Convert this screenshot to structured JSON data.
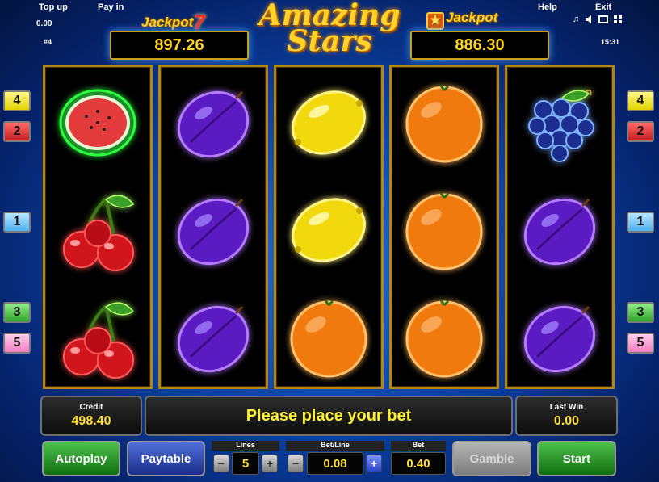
{
  "topbar": {
    "top_up": "Top up",
    "pay_in": "Pay in",
    "help": "Help",
    "exit": "Exit",
    "balance": "0.00",
    "game_no": "#4",
    "clock": "15:31"
  },
  "jackpots": {
    "left_label": "Jackpot",
    "left_symbol": "7",
    "left_value": "897.26",
    "right_label": "Jackpot",
    "right_value": "886.30"
  },
  "logo": {
    "line1": "Amazing",
    "line2": "Stars"
  },
  "reels": [
    [
      "watermelon",
      "cherries",
      "cherries"
    ],
    [
      "plum",
      "plum",
      "plum"
    ],
    [
      "lemon",
      "lemon",
      "orange"
    ],
    [
      "orange",
      "orange",
      "orange"
    ],
    [
      "grapes",
      "plum",
      "plum"
    ]
  ],
  "lines": {
    "left": [
      "4",
      "2",
      "1",
      "3",
      "5"
    ],
    "right": [
      "4",
      "2",
      "1",
      "3",
      "5"
    ]
  },
  "panel": {
    "credit_label": "Credit",
    "credit": "498.40",
    "message": "Please place your bet",
    "last_win_label": "Last Win",
    "last_win": "0.00"
  },
  "controls": {
    "autoplay": "Autoplay",
    "paytable": "Paytable",
    "lines_label": "Lines",
    "lines": "5",
    "betline_label": "Bet/Line",
    "betline": "0.08",
    "bet_label": "Bet",
    "bet": "0.40",
    "gamble": "Gamble",
    "start": "Start",
    "minus": "−",
    "plus": "+"
  },
  "colors": {
    "gold": "#ffd21e",
    "message_yellow": "#fff12e",
    "background_blue": "#0b3fa0"
  }
}
